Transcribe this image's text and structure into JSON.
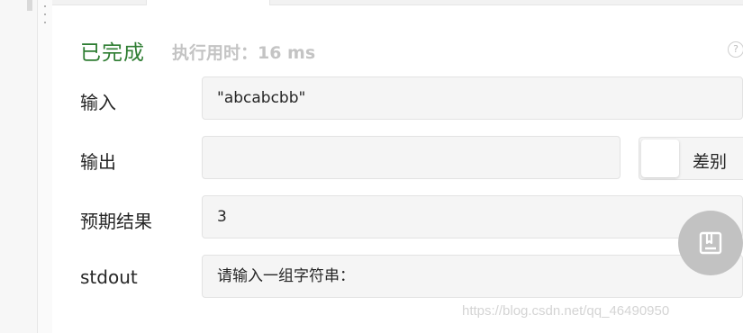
{
  "result": {
    "status": "已完成",
    "runtime": "执行用时：16 ms"
  },
  "rows": [
    {
      "label": "输入",
      "value": "\"abcabcbb\""
    },
    {
      "label": "输出",
      "value": ""
    },
    {
      "label": "预期结果",
      "value": "3"
    },
    {
      "label": "stdout",
      "value": "请输入一组字符串："
    }
  ],
  "diff": {
    "label": "差别"
  },
  "watermark": "https://blog.csdn.net/qq_46490950",
  "icons": {
    "help": "question-circle-icon",
    "fab": "notebook-icon",
    "drag": "drag-handle-icon"
  },
  "colors": {
    "status_green": "#2e7d32",
    "runtime_gray": "#c4c4c4",
    "field_bg": "#f5f5f5",
    "fab_bg": "#c2c2c2"
  }
}
